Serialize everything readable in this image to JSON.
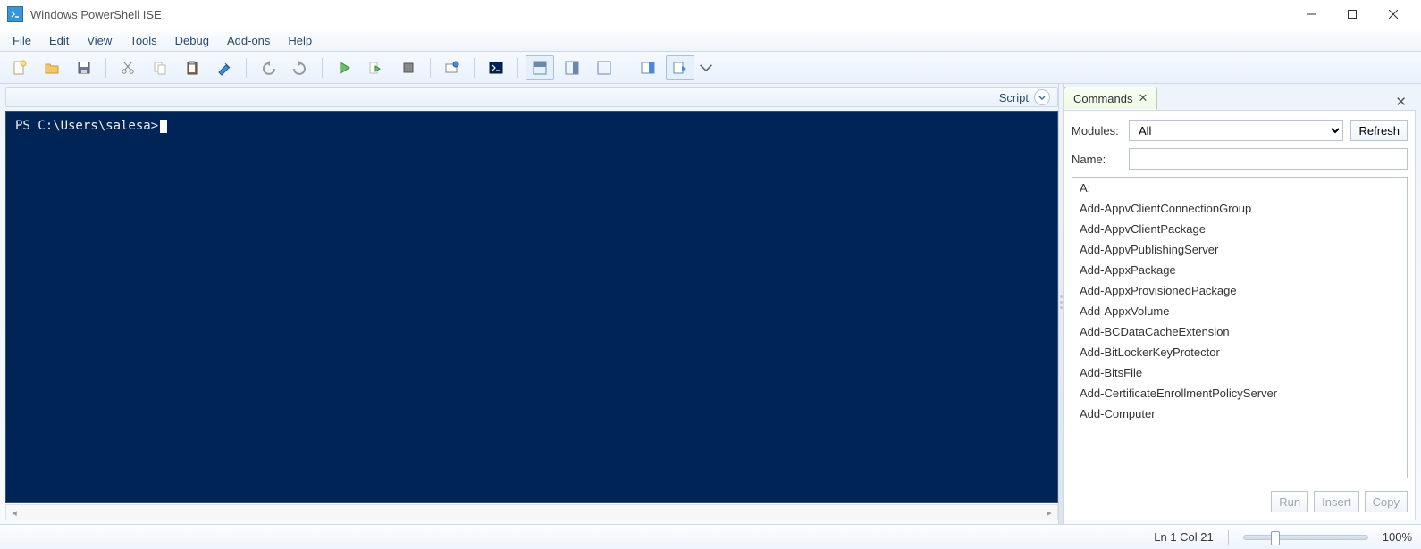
{
  "window": {
    "title": "Windows PowerShell ISE"
  },
  "menu": {
    "items": [
      "File",
      "Edit",
      "View",
      "Tools",
      "Debug",
      "Add-ons",
      "Help"
    ]
  },
  "scriptBar": {
    "label": "Script"
  },
  "console": {
    "prompt": "PS C:\\Users\\salesa>"
  },
  "commands": {
    "tabLabel": "Commands",
    "modulesLabel": "Modules:",
    "modulesSelected": "All",
    "refreshLabel": "Refresh",
    "nameLabel": "Name:",
    "nameValue": "",
    "list": [
      "A:",
      "Add-AppvClientConnectionGroup",
      "Add-AppvClientPackage",
      "Add-AppvPublishingServer",
      "Add-AppxPackage",
      "Add-AppxProvisionedPackage",
      "Add-AppxVolume",
      "Add-BCDataCacheExtension",
      "Add-BitLockerKeyProtector",
      "Add-BitsFile",
      "Add-CertificateEnrollmentPolicyServer",
      "Add-Computer"
    ],
    "runLabel": "Run",
    "insertLabel": "Insert",
    "copyLabel": "Copy"
  },
  "status": {
    "position": "Ln 1  Col 21",
    "zoom": "100%"
  }
}
